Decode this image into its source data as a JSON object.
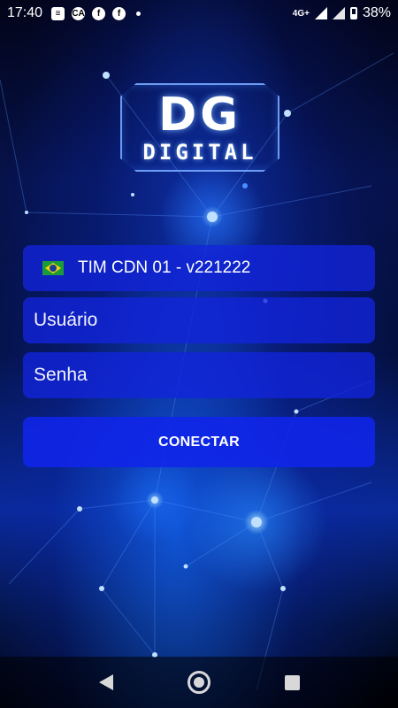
{
  "status_bar": {
    "time": "17:40",
    "network": "4G+",
    "battery": "38%",
    "notification_icons": [
      "message-icon",
      "ca-icon",
      "facebook-icon",
      "facebook-icon"
    ]
  },
  "logo": {
    "line1": "DG",
    "line2": "DIGITAL"
  },
  "form": {
    "server_label": "TIM CDN 01 - v221222",
    "server_flag": "brazil-flag-icon",
    "username_placeholder": "Usuário",
    "password_placeholder": "Senha",
    "connect_label": "CONECTAR"
  },
  "colors": {
    "field_bg": "#1224DC",
    "button_bg": "#1024EB",
    "background_dark": "#020418"
  }
}
